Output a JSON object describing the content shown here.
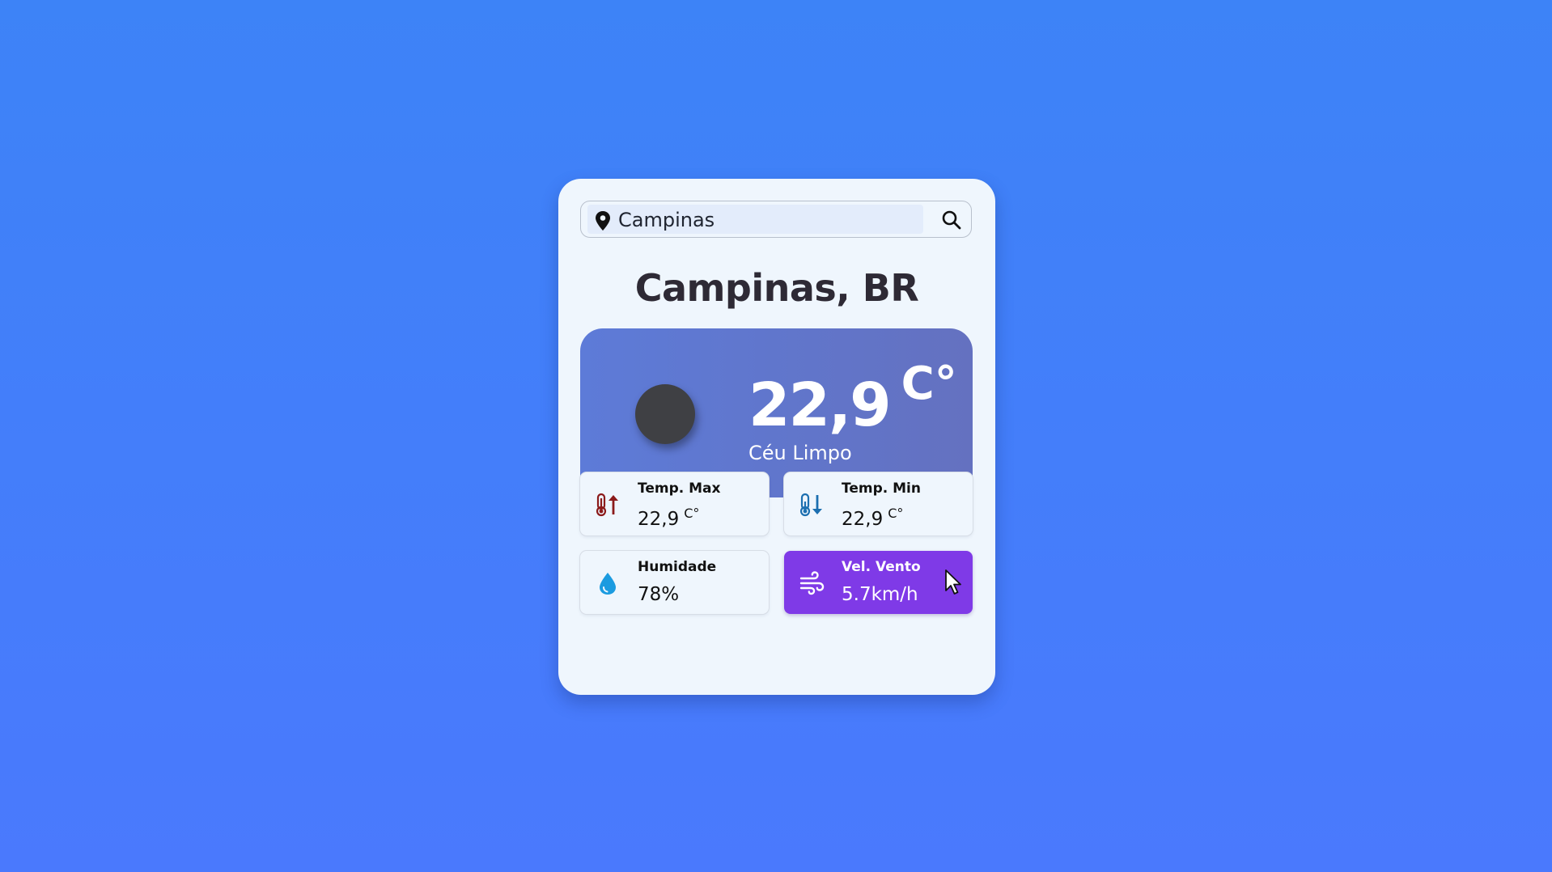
{
  "search": {
    "value": "Campinas",
    "placeholder": "",
    "location_icon": "map-pin-icon",
    "search_icon": "magnifier-icon"
  },
  "location": {
    "name": "Campinas, BR"
  },
  "current": {
    "temperature": "22,9",
    "unit": "C°",
    "condition": "Céu Limpo",
    "icon": "weather-icon-placeholder"
  },
  "details": [
    {
      "label": "Temp. Max",
      "value": "22,9",
      "unit": "C°",
      "icon": "thermometer-up-icon",
      "icon_color": "#8b1a1a"
    },
    {
      "label": "Temp. Min",
      "value": "22,9",
      "unit": "C°",
      "icon": "thermometer-down-icon",
      "icon_color": "#1c6fb0"
    },
    {
      "label": "Humidade",
      "value": "78%",
      "icon": "water-drop-icon",
      "icon_color": "#1b9be0"
    },
    {
      "label": "Vel. Vento",
      "value": "5.7km/h",
      "icon": "wind-icon",
      "icon_color": "#ffffff",
      "highlight": "#7f3ae7"
    }
  ],
  "colors": {
    "background": "#4280fa",
    "card": "#eff6fd",
    "accent": "#7f3ae7",
    "hero_gradient_start": "#5d7bd8",
    "hero_gradient_end": "#6471c0"
  }
}
